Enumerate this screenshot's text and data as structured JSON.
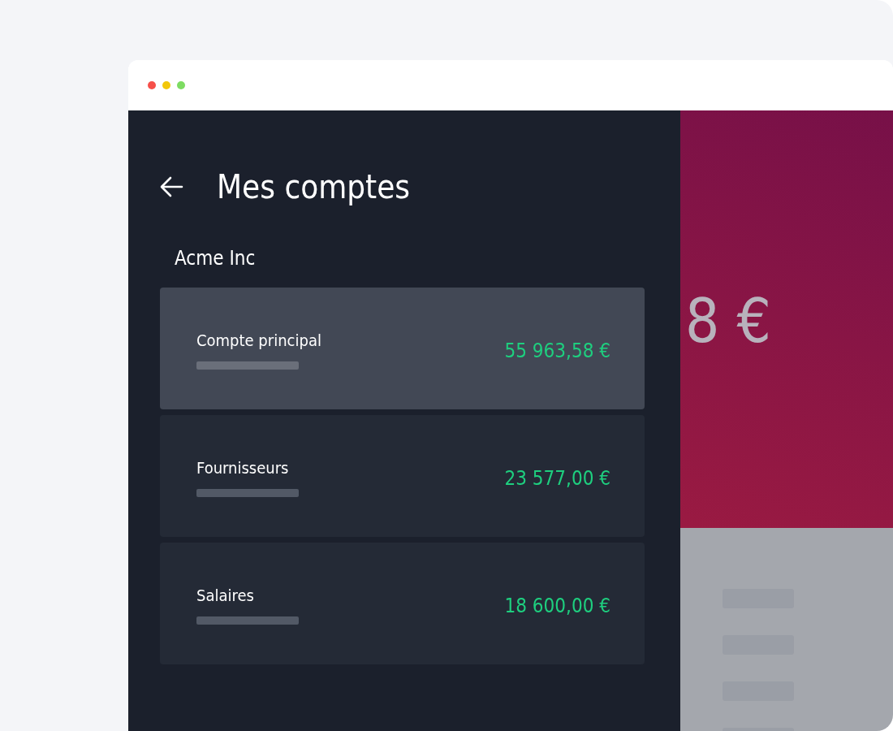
{
  "window": {
    "title": "Mes comptes"
  },
  "section": {
    "label": "Acme Inc"
  },
  "accounts": [
    {
      "name": "Compte principal",
      "amount": "55 963,58 €",
      "selected": true
    },
    {
      "name": "Fournisseurs",
      "amount": "23 577,00 €",
      "selected": false
    },
    {
      "name": "Salaires",
      "amount": "18 600,00 €",
      "selected": false
    }
  ],
  "detail_panel": {
    "amount_partial": "8 €"
  }
}
